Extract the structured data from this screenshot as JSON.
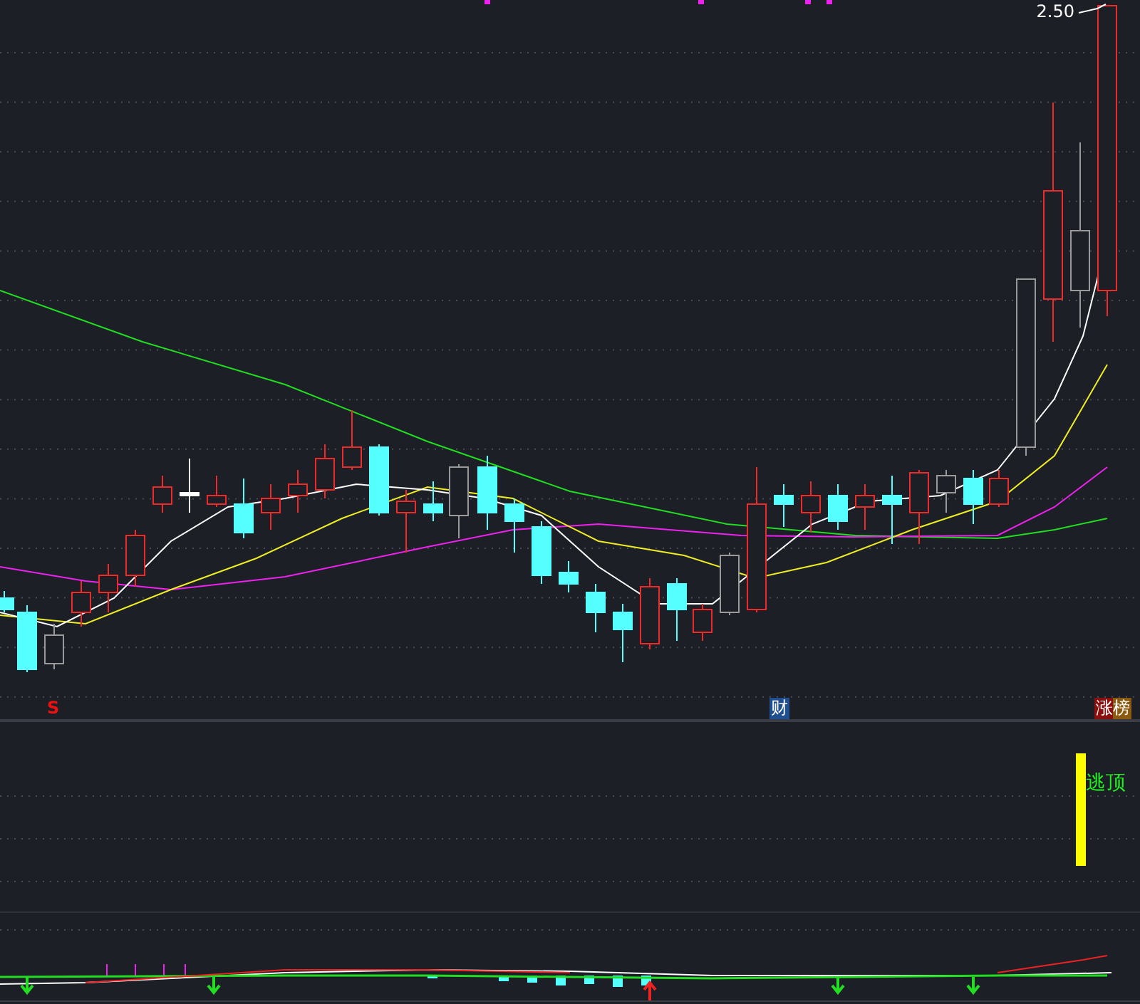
{
  "main_chart": {
    "price_label": "2.50",
    "markers": [
      {
        "text": "S",
        "kind": "signal"
      },
      {
        "text": "财",
        "kind": "finance"
      },
      {
        "text": "涨榜",
        "kind": "rank"
      }
    ]
  },
  "indicator_panel": {
    "signal_label": "逃顶"
  }
}
